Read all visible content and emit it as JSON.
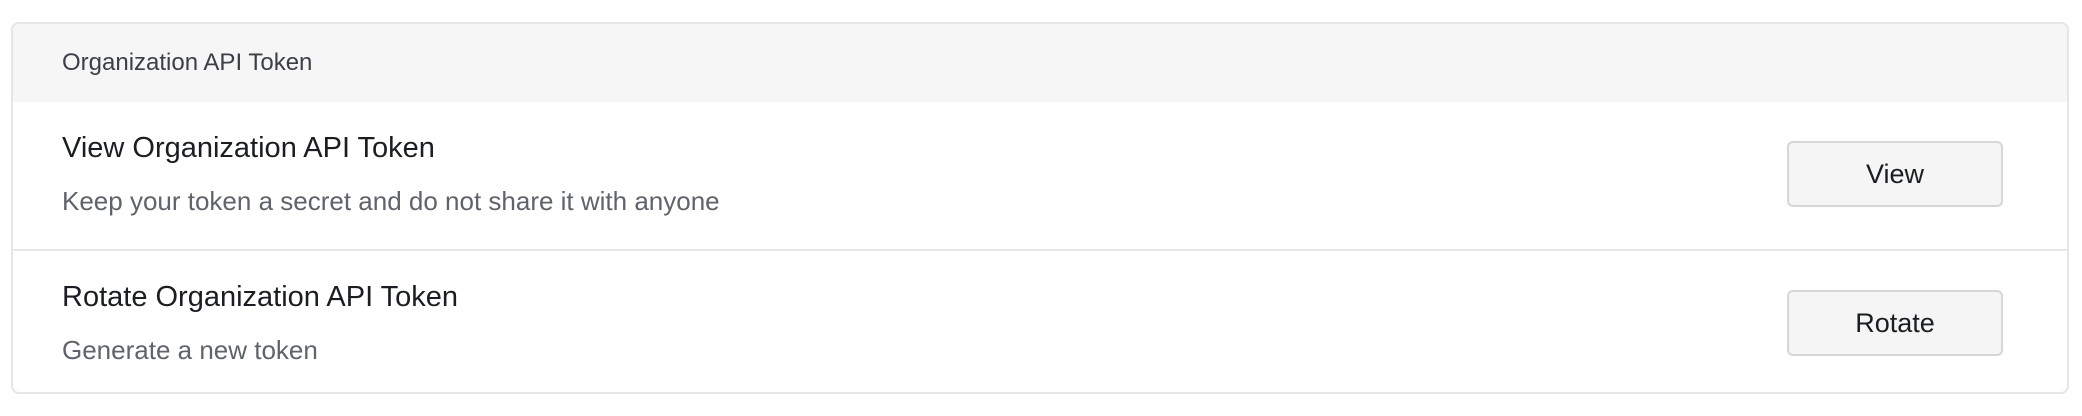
{
  "section": {
    "header_title": "Organization API Token"
  },
  "rows": [
    {
      "title": "View Organization API Token",
      "description": "Keep your token a secret and do not share it with anyone",
      "button_label": "View"
    },
    {
      "title": "Rotate Organization API Token",
      "description": "Generate a new token",
      "button_label": "Rotate"
    }
  ],
  "colors": {
    "header_background": "#f6f6f6",
    "border": "#e6e6e6",
    "button_background": "#f5f5f5",
    "title_text": "#1a1d21",
    "description_text": "#5f646b"
  }
}
